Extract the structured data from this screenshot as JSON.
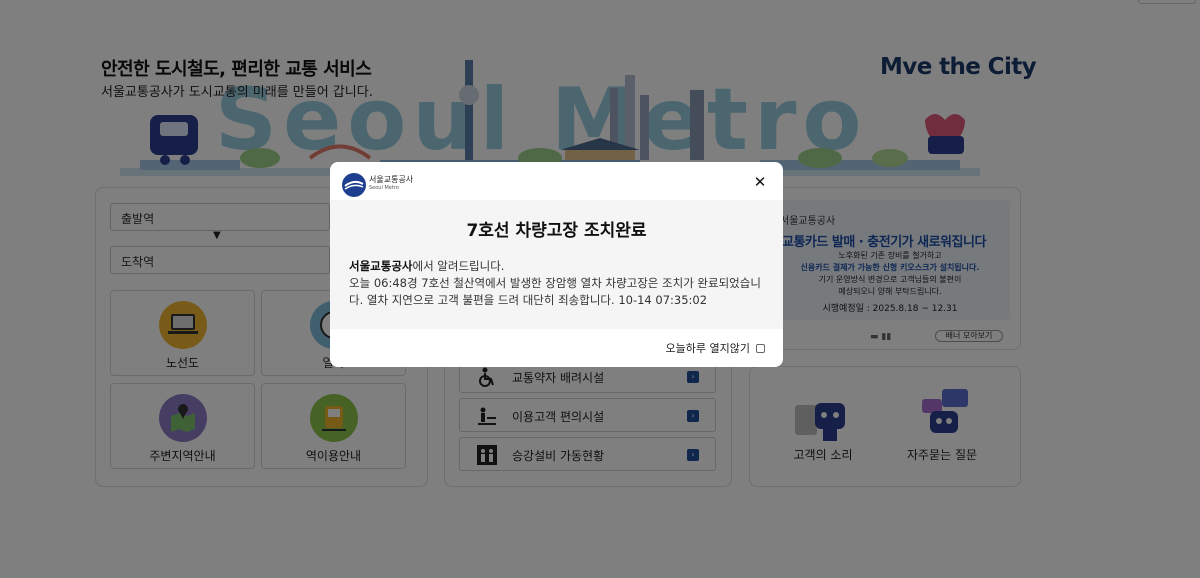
{
  "hero": {
    "title": "안전한 도시철도, 편리한 교통 서비스",
    "subtitle": "서울교통공사가 도시교통의 미래를 만들어 갑니다.",
    "slogan_pre": "M",
    "slogan_ve": "ve",
    "slogan_post": " the City",
    "banner_word": "Seoul Metro"
  },
  "route_search": {
    "departure_placeholder": "출발역",
    "arrival_placeholder": "도착역"
  },
  "quick_tiles": [
    {
      "label": "노선도",
      "icon": "route-map-icon"
    },
    {
      "label": "열차",
      "icon": "train-time-icon"
    },
    {
      "label": "주변지역안내",
      "icon": "map-pin-icon"
    },
    {
      "label": "역이용안내",
      "icon": "station-train-icon"
    }
  ],
  "facility_links": [
    {
      "label": "교통약자 배려시설",
      "icon": "wheelchair-icon"
    },
    {
      "label": "이용고객 편의시설",
      "icon": "convenience-icon"
    },
    {
      "label": "승강설비 가동현황",
      "icon": "elevator-icon"
    }
  ],
  "banner": {
    "org": "서울교통공사",
    "headline": "교통카드 발매 · 충전기가 새로워집니다",
    "line1": "노후화된 기존 장비를 철거하고",
    "line2": "신용카드 결제가 가능한 신형 키오스크가 설치됩니다.",
    "line3": "기기 운영방식 변경으로 고객님들의 불편이",
    "line4": "예상되오니 양해 부탁드립니다.",
    "line5": "시행예정일 : 2025.8.18 ~ 12.31",
    "pager": "▬ ▮▮",
    "more_label": "배너 모아보기"
  },
  "customer": [
    {
      "label": "고객의 소리",
      "icon": "customer-voice-icon"
    },
    {
      "label": "자주묻는 질문",
      "icon": "faq-icon"
    }
  ],
  "modal": {
    "org_ko": "서울교통공사",
    "org_en": "Seoul Metro",
    "close_symbol": "✕",
    "title": "7호선 차량고장 조치완료",
    "msg_org": "서울교통공사",
    "msg_intro": "에서 알려드립니다.",
    "msg_body": "오늘 06:48경 7호선 철산역에서 발생한 장암행 열차 차량고장은 조치가 완료되었습니다. 열차 지연으로 고객 불편을 드려 대단히 죄송합니다. 10-14 07:35:02",
    "dont_show_label": "오늘하루 열지않기"
  },
  "colors": {
    "accent_blue": "#1e4c9a",
    "banner_blue": "#1e4ea8",
    "sky_blue": "#8fc7dc"
  }
}
